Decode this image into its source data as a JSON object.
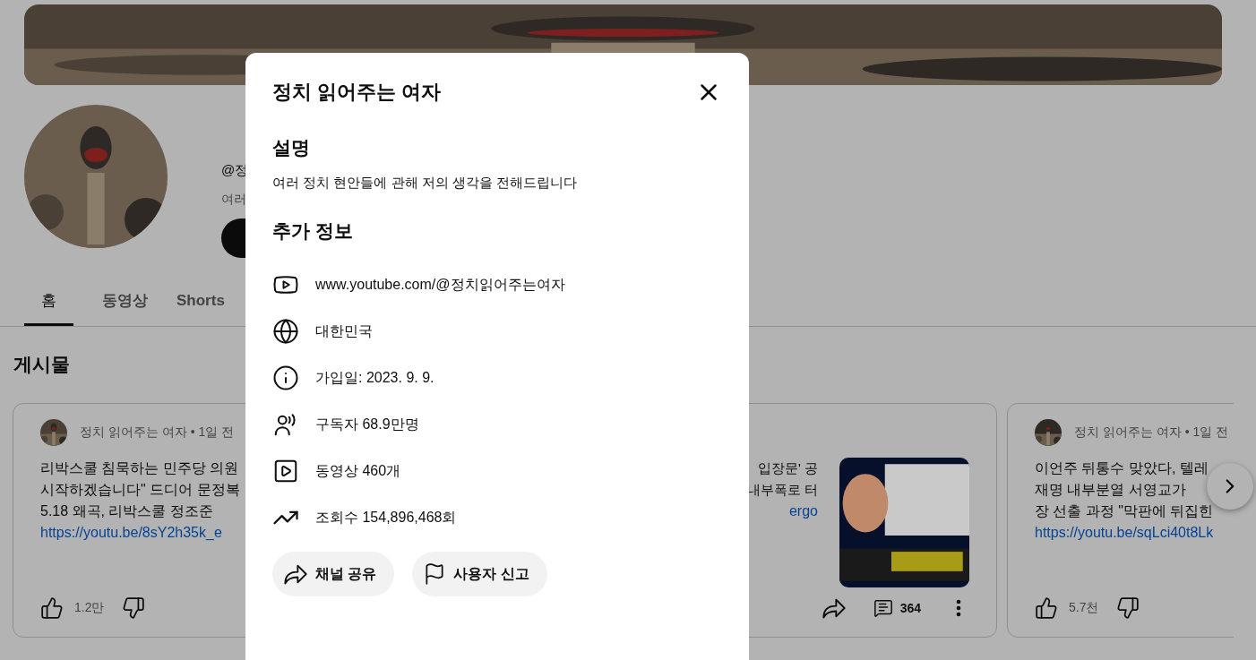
{
  "banner": {
    "kind": "picture"
  },
  "channel": {
    "avatar": {
      "kind": "picture"
    },
    "handle": "@정",
    "description": "여러"
  },
  "tabs": [
    {
      "label": "홈",
      "selected": true
    },
    {
      "label": "동영상",
      "selected": false
    },
    {
      "label": "Shorts",
      "selected": false
    }
  ],
  "section_title": "게시물",
  "posts": [
    {
      "kind": "text",
      "meta": "정치 읽어주는 여자 • 1일 전",
      "lines": [
        "리박스쿨 침묵하는 민주당 의원",
        "시작하겠습니다\" 드디어 문정복",
        "5.18 왜곡, 리박스쿨 정조준"
      ],
      "link": "https://youtu.be/8sY2h35k_e",
      "likes": "1.2만"
    },
    {
      "kind": "video",
      "lines": [
        "입장문' 공",
        "내부폭로 터"
      ],
      "link": "ergo",
      "thumbnail": {
        "kind": "picture"
      },
      "comments": "364"
    },
    {
      "kind": "text",
      "meta": "정치 읽어주는 여자 • 1일 전",
      "lines": [
        "이언주 뒤통수 맞았다, 텔레",
        "재명 내부분열 서영교가",
        "장 선출 과정 \"막판에 뒤집힌"
      ],
      "link": "https://youtu.be/sqLci40t8Lk",
      "likes": "5.7천"
    }
  ],
  "dialog": {
    "title": "정치 읽어주는 여자",
    "sections": [
      {
        "heading": "설명",
        "text": "여러 정치 현안들에 관해 저의 생각을 전해드립니다"
      },
      {
        "heading": "추가 정보"
      }
    ],
    "details": [
      {
        "kind": "link",
        "text": "www.youtube.com/@정치읽어주는여자"
      },
      {
        "kind": "country",
        "text": "대한민국"
      },
      {
        "kind": "joined",
        "text": "가입일: 2023. 9. 9."
      },
      {
        "kind": "subscribers",
        "text": "구독자 68.9만명"
      },
      {
        "kind": "videos",
        "text": "동영상 460개"
      },
      {
        "kind": "views",
        "text": "조회수 154,896,468회"
      }
    ],
    "buttons": [
      {
        "kind": "share",
        "label": "채널 공유"
      },
      {
        "kind": "report",
        "label": "사용자 신고"
      }
    ]
  }
}
